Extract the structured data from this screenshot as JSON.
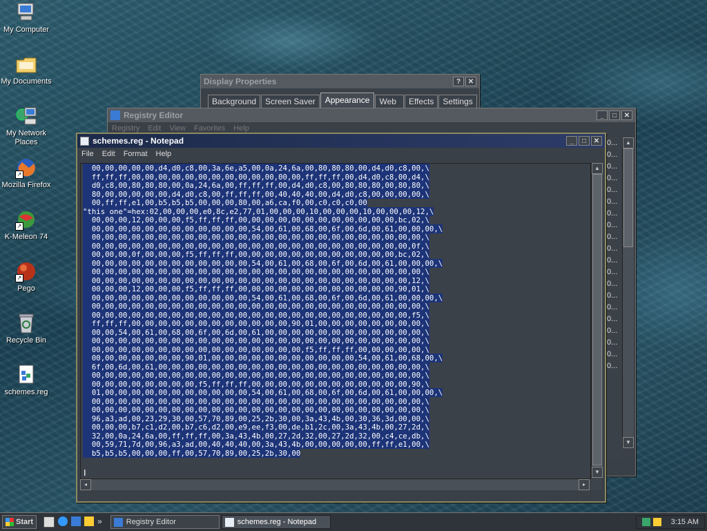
{
  "desktop": {
    "icons": [
      {
        "label": "My Computer",
        "icon": "computer-icon"
      },
      {
        "label": "My Documents",
        "icon": "folder-icon"
      },
      {
        "label": "My Network Places",
        "icon": "network-icon"
      },
      {
        "label": "Mozilla Firefox",
        "icon": "firefox-icon"
      },
      {
        "label": "K-Meleon 74",
        "icon": "kmeleon-icon"
      },
      {
        "label": "Pego",
        "icon": "pego-icon"
      },
      {
        "label": "Recycle Bin",
        "icon": "recycle-bin-icon"
      },
      {
        "label": "schemes.reg",
        "icon": "registry-file-icon"
      }
    ]
  },
  "display_properties": {
    "title": "Display Properties",
    "help_btn": "?",
    "close_btn": "✕",
    "tabs": [
      "Background",
      "Screen Saver",
      "Appearance",
      "Web",
      "Effects",
      "Settings"
    ],
    "active_tab": "Appearance"
  },
  "registry_editor": {
    "title": "Registry Editor",
    "menu": [
      "Registry",
      "Edit",
      "View",
      "Favorites",
      "Help"
    ],
    "right_list": [
      "0...",
      "0...",
      "0...",
      "0...",
      "0...",
      "0...",
      "0...",
      "0...",
      "0...",
      "0...",
      "0...",
      "0...",
      "0...",
      "0...",
      "0...",
      "0...",
      "0...",
      "0...",
      "0...",
      "0..."
    ]
  },
  "notepad": {
    "title": "schemes.reg - Notepad",
    "menu": [
      "File",
      "Edit",
      "Format",
      "Help"
    ],
    "lines": [
      "  00,00,00,00,00,d4,d0,c8,00,3a,6e,a5,00,0a,24,6a,00,80,80,80,00,d4,d0,c8,00,\\",
      "  ff,ff,ff,00,00,00,00,00,00,00,00,00,00,00,00,00,ff,ff,ff,00,d4,d0,c8,00,d4,\\",
      "  d0,c8,00,80,80,80,00,0a,24,6a,00,ff,ff,ff,00,d4,d0,c8,00,80,80,80,00,80,80,\\",
      "  80,00,00,00,00,00,d4,d0,c8,00,ff,ff,ff,00,40,40,40,00,d4,d0,c8,00,00,00,00,\\",
      "  00,ff,ff,e1,00,b5,b5,b5,00,00,00,80,00,a6,ca,f0,00,c0,c0,c0,00",
      "\"this one\"=hex:02,00,00,00,e0,8c,e2,77,01,00,00,00,10,00,00,00,10,00,00,00,12,\\",
      "  00,00,00,12,00,00,00,f5,ff,ff,ff,00,00,00,00,00,00,00,00,00,00,00,00,bc,02,\\",
      "  00,00,00,00,00,00,00,00,00,00,00,00,54,00,61,00,68,00,6f,00,6d,00,61,00,00,00,\\",
      "  00,00,00,00,00,00,00,00,00,00,00,00,00,00,00,00,00,00,00,00,00,00,00,00,00,\\",
      "  00,00,00,00,00,00,00,00,00,00,00,00,00,00,00,00,00,00,00,00,00,00,00,00,0f,\\",
      "  00,00,00,0f,00,00,00,f5,ff,ff,ff,00,00,00,00,00,00,00,00,00,00,00,00,bc,02,\\",
      "  00,00,00,00,00,00,00,00,00,00,00,00,54,00,61,00,68,00,6f,00,6d,00,61,00,00,00,\\",
      "  00,00,00,00,00,00,00,00,00,00,00,00,00,00,00,00,00,00,00,00,00,00,00,00,00,\\",
      "  00,00,00,00,00,00,00,00,00,00,00,00,00,00,00,00,00,00,00,00,00,00,00,00,12,\\",
      "  00,00,00,12,00,00,00,f5,ff,ff,ff,00,00,00,00,00,00,00,00,00,00,00,00,90,01,\\",
      "  00,00,00,00,00,00,00,00,00,00,00,00,54,00,61,00,68,00,6f,00,6d,00,61,00,00,00,\\",
      "  00,00,00,00,00,00,00,00,00,00,00,00,00,00,00,00,00,00,00,00,00,00,00,00,00,\\",
      "  00,00,00,00,00,00,00,00,00,00,00,00,00,00,00,00,00,00,00,00,00,00,00,00,f5,\\",
      "  ff,ff,ff,00,00,00,00,00,00,00,00,00,00,00,00,90,01,00,00,00,00,00,00,00,00,\\",
      "  00,00,54,00,61,00,68,00,6f,00,6d,00,61,00,00,00,00,00,00,00,00,00,00,00,00,\\",
      "  00,00,00,00,00,00,00,00,00,00,00,00,00,00,00,00,00,00,00,00,00,00,00,00,00,\\",
      "  00,00,00,00,00,00,00,00,00,00,00,00,00,00,00,00,f5,ff,ff,ff,00,00,00,00,00,\\",
      "  00,00,00,00,00,00,00,90,01,00,00,00,00,00,00,00,00,00,00,00,54,00,61,00,68,00,\\",
      "  6f,00,6d,00,61,00,00,00,00,00,00,00,00,00,00,00,00,00,00,00,00,00,00,00,00,\\",
      "  00,00,00,00,00,00,00,00,00,00,00,00,00,00,00,00,00,00,00,00,00,00,00,00,00,\\",
      "  00,00,00,00,00,00,00,00,f5,ff,ff,ff,00,00,00,00,00,00,00,00,00,00,00,00,90,\\",
      "  01,00,00,00,00,00,00,00,00,00,00,00,54,00,61,00,68,00,6f,00,6d,00,61,00,00,00,\\",
      "  00,00,00,00,00,00,00,00,00,00,00,00,00,00,00,00,00,00,00,00,00,00,00,00,00,\\",
      "  00,00,00,00,00,00,00,00,00,00,00,00,00,00,00,00,00,00,00,00,00,00,00,00,00,\\",
      "  96,a3,ad,00,23,29,30,00,57,70,89,00,25,2b,30,00,3a,43,4b,00,30,36,3d,00,00,\\",
      "  00,00,00,b7,c1,d2,00,b7,c6,d2,00,e9,ee,f3,00,de,b1,2c,00,3a,43,4b,00,27,2d,\\",
      "  32,00,0a,24,6a,00,ff,ff,ff,00,3a,43,4b,00,27,2d,32,00,27,2d,32,00,c4,ce,db,\\",
      "  00,59,71,7d,00,96,a3,ad,00,40,40,40,00,3a,43,4b,00,00,00,00,00,ff,ff,e1,00,\\",
      "  b5,b5,b5,00,00,00,ff,00,57,70,89,00,25,2b,30,00"
    ]
  },
  "taskbar": {
    "start_label": "Start",
    "tasks": [
      {
        "label": "Registry Editor",
        "icon": "registry-editor-icon",
        "active": false
      },
      {
        "label": "schemes.reg - Notepad",
        "icon": "notepad-icon",
        "active": true
      }
    ],
    "quicklaunch": [
      "show-desktop-icon",
      "ie-icon",
      "outlook-icon",
      "media-icon"
    ],
    "chevron": "»",
    "clock": "3:15 AM"
  },
  "colors": {
    "selection": "#1d3478",
    "window_bg": "#3a4048",
    "title_active": "#1c2a4a"
  }
}
